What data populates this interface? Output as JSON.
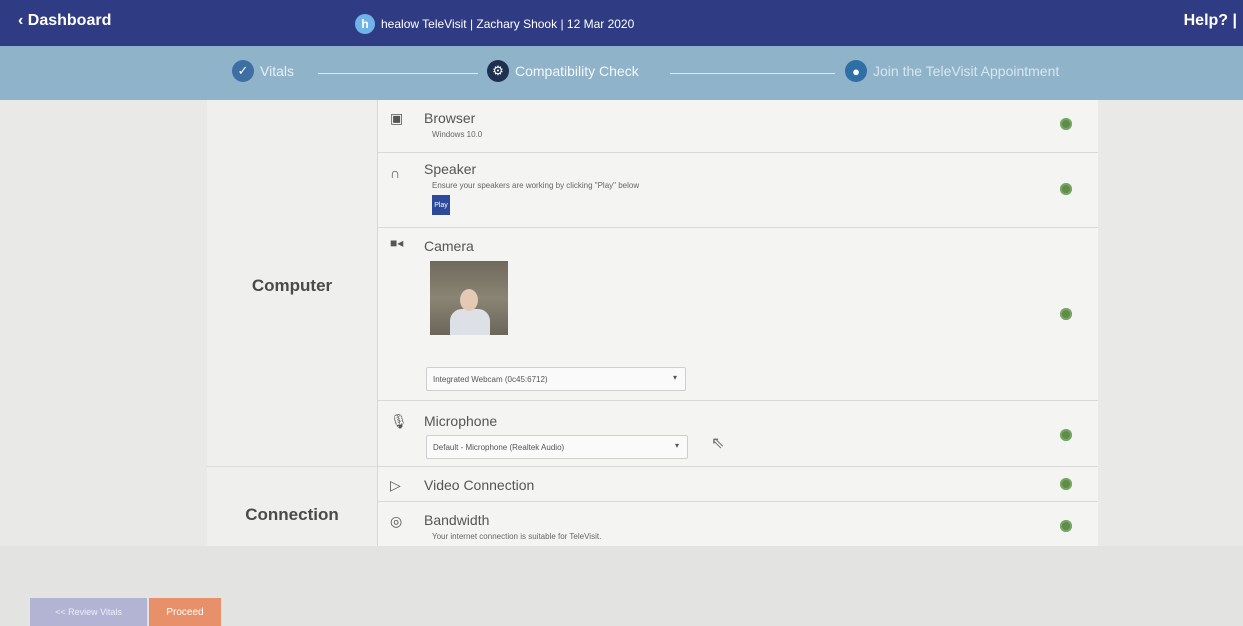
{
  "topbar": {
    "back_label": "Dashboard",
    "app_name": "healow TeleVisit | Zachary Shook | 12 Mar 2020",
    "help_label": "Help? |"
  },
  "stepper": {
    "steps": [
      {
        "label": "Vitals",
        "state": "done"
      },
      {
        "label": "Compatibility Check",
        "state": "current"
      },
      {
        "label": "Join the TeleVisit Appointment",
        "state": "upcoming"
      }
    ]
  },
  "sections": {
    "computer": "Computer",
    "connection": "Connection"
  },
  "checks": {
    "browser": {
      "title": "Browser",
      "sub": "Windows 10.0"
    },
    "speaker": {
      "title": "Speaker",
      "sub": "Ensure your speakers are working by clicking \"Play\" below",
      "play": "Play"
    },
    "camera": {
      "title": "Camera",
      "select_value": "Integrated Webcam (0c45:6712)"
    },
    "microphone": {
      "title": "Microphone",
      "select_value": "Default - Microphone (Realtek Audio)"
    },
    "video": {
      "title": "Video Connection"
    },
    "bandwidth": {
      "title": "Bandwidth",
      "sub": "Your internet connection is suitable for TeleVisit."
    }
  },
  "footer": {
    "review_label": "<< Review Vitals",
    "proceed_label": "Proceed"
  },
  "colors": {
    "topbar": "#2f3b83",
    "stepper": "#8fb3c9",
    "status_ok": "#5e8d4a",
    "play_button": "#2d4a9a",
    "proceed_button": "#e8906a"
  }
}
